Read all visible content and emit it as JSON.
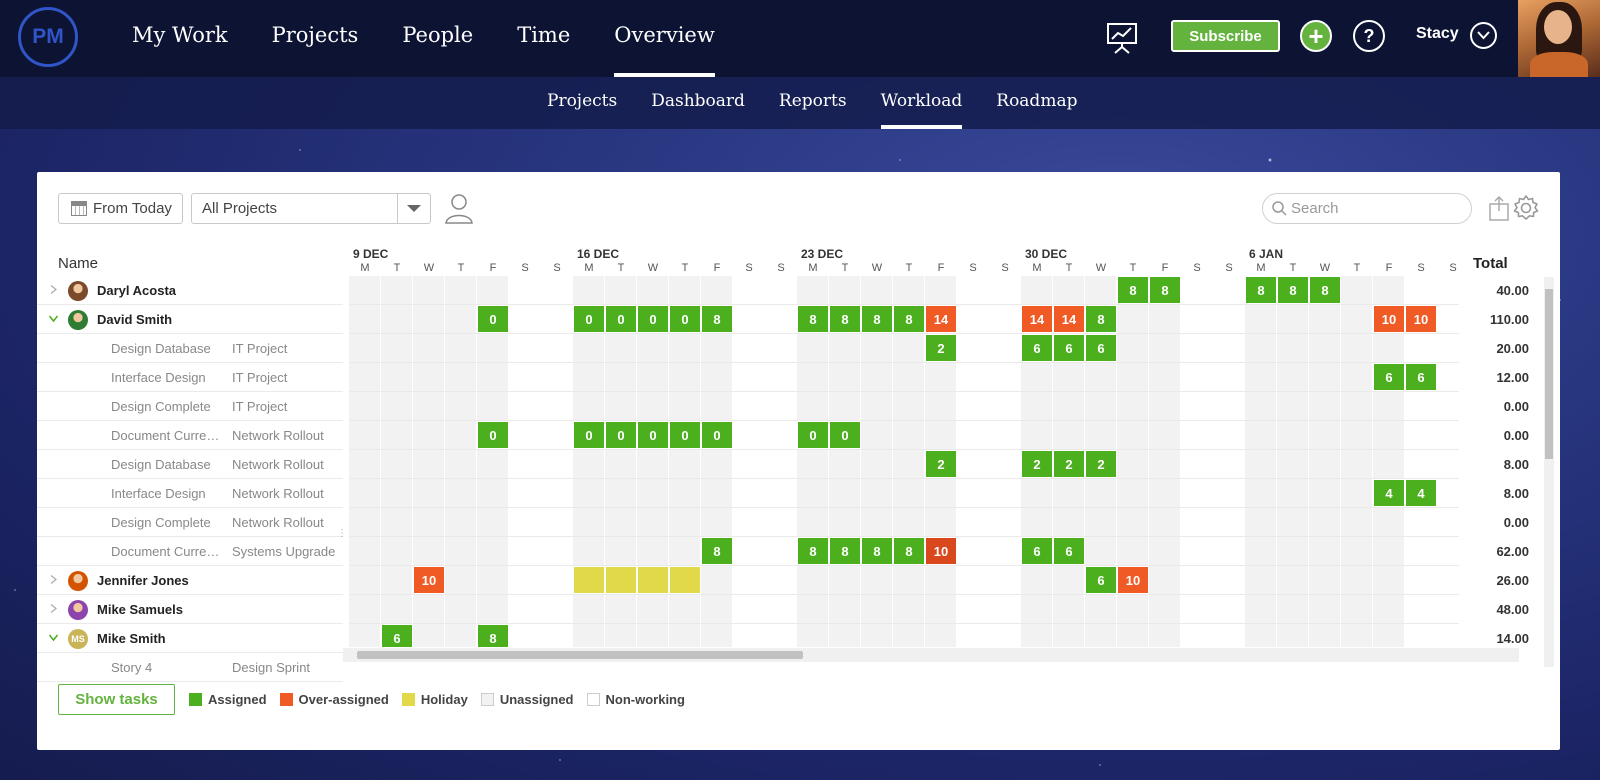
{
  "app": {
    "logo_text": "PM"
  },
  "main_nav": [
    {
      "label": "My Work",
      "active": false
    },
    {
      "label": "Projects",
      "active": false
    },
    {
      "label": "People",
      "active": false
    },
    {
      "label": "Time",
      "active": false
    },
    {
      "label": "Overview",
      "active": true
    }
  ],
  "sub_nav": [
    {
      "label": "Projects",
      "active": false
    },
    {
      "label": "Dashboard",
      "active": false
    },
    {
      "label": "Reports",
      "active": false
    },
    {
      "label": "Workload",
      "active": true
    },
    {
      "label": "Roadmap",
      "active": false
    }
  ],
  "header_actions": {
    "subscribe_label": "Subscribe",
    "user_name": "Stacy"
  },
  "toolbar": {
    "from_today_label": "From Today",
    "project_filter": "All Projects",
    "search_placeholder": "Search"
  },
  "colors": {
    "assigned": "#4caf1e",
    "over_assigned": "#f05a24",
    "over_assigned_dark": "#d9471d",
    "holiday": "#e2d94a",
    "unassigned": "#f2f2f2",
    "nonworking": "#ffffff",
    "accent": "#63b33e"
  },
  "grid": {
    "name_header": "Name",
    "total_header": "Total",
    "weeks": [
      "9 DEC",
      "16 DEC",
      "23 DEC",
      "30 DEC",
      "6 JAN"
    ],
    "day_letters": [
      "M",
      "T",
      "W",
      "T",
      "F",
      "S",
      "S"
    ],
    "rows": [
      {
        "type": "person",
        "name": "Daryl Acosta",
        "expanded": false,
        "avatar": "#7a4a2a",
        "total": "40.00",
        "cells": [
          [
            24,
            "8",
            "a"
          ],
          [
            25,
            "8",
            "a"
          ],
          [
            28,
            "8",
            "a"
          ],
          [
            29,
            "8",
            "a"
          ],
          [
            30,
            "8",
            "a"
          ]
        ]
      },
      {
        "type": "person",
        "name": "David Smith",
        "expanded": true,
        "avatar": "#2e7d32",
        "total": "110.00",
        "cells": [
          [
            4,
            "0",
            "a"
          ],
          [
            7,
            "0",
            "a"
          ],
          [
            8,
            "0",
            "a"
          ],
          [
            9,
            "0",
            "a"
          ],
          [
            10,
            "0",
            "a"
          ],
          [
            11,
            "8",
            "a"
          ],
          [
            14,
            "8",
            "a"
          ],
          [
            15,
            "8",
            "a"
          ],
          [
            16,
            "8",
            "a"
          ],
          [
            17,
            "8",
            "a"
          ],
          [
            18,
            "14",
            "o"
          ],
          [
            21,
            "14",
            "o"
          ],
          [
            22,
            "14",
            "o"
          ],
          [
            23,
            "8",
            "a"
          ],
          [
            32,
            "10",
            "o"
          ],
          [
            33,
            "10",
            "o"
          ]
        ]
      },
      {
        "type": "task",
        "task": "Design Database",
        "project": "IT Project",
        "total": "20.00",
        "cells": [
          [
            18,
            "2",
            "a"
          ],
          [
            21,
            "6",
            "a"
          ],
          [
            22,
            "6",
            "a"
          ],
          [
            23,
            "6",
            "a"
          ]
        ]
      },
      {
        "type": "task",
        "task": "Interface Design",
        "project": "IT Project",
        "total": "12.00",
        "cells": [
          [
            32,
            "6",
            "a"
          ],
          [
            33,
            "6",
            "a"
          ]
        ]
      },
      {
        "type": "task",
        "task": "Design Complete",
        "project": "IT Project",
        "total": "0.00",
        "cells": []
      },
      {
        "type": "task",
        "task": "Document Current...",
        "project": "Network Rollout",
        "total": "0.00",
        "cells": [
          [
            4,
            "0",
            "a"
          ],
          [
            7,
            "0",
            "a"
          ],
          [
            8,
            "0",
            "a"
          ],
          [
            9,
            "0",
            "a"
          ],
          [
            10,
            "0",
            "a"
          ],
          [
            11,
            "0",
            "a"
          ],
          [
            14,
            "0",
            "a"
          ],
          [
            15,
            "0",
            "a"
          ]
        ]
      },
      {
        "type": "task",
        "task": "Design Database",
        "project": "Network Rollout",
        "total": "8.00",
        "cells": [
          [
            18,
            "2",
            "a"
          ],
          [
            21,
            "2",
            "a"
          ],
          [
            22,
            "2",
            "a"
          ],
          [
            23,
            "2",
            "a"
          ]
        ]
      },
      {
        "type": "task",
        "task": "Interface Design",
        "project": "Network Rollout",
        "total": "8.00",
        "cells": [
          [
            32,
            "4",
            "a"
          ],
          [
            33,
            "4",
            "a"
          ]
        ]
      },
      {
        "type": "task",
        "task": "Design Complete",
        "project": "Network Rollout",
        "total": "0.00",
        "cells": []
      },
      {
        "type": "task",
        "task": "Document Current...",
        "project": "Systems Upgrade",
        "total": "62.00",
        "cells": [
          [
            11,
            "8",
            "a"
          ],
          [
            14,
            "8",
            "a"
          ],
          [
            15,
            "8",
            "a"
          ],
          [
            16,
            "8",
            "a"
          ],
          [
            17,
            "8",
            "a"
          ],
          [
            18,
            "10",
            "od"
          ],
          [
            21,
            "6",
            "a"
          ],
          [
            22,
            "6",
            "a"
          ]
        ]
      },
      {
        "type": "person",
        "name": "Jennifer Jones",
        "expanded": false,
        "avatar": "#d35400",
        "total": "26.00",
        "cells": [
          [
            2,
            "10",
            "o"
          ],
          [
            7,
            "",
            "h"
          ],
          [
            8,
            "",
            "h"
          ],
          [
            9,
            "",
            "h"
          ],
          [
            10,
            "",
            "h"
          ],
          [
            23,
            "6",
            "a"
          ],
          [
            24,
            "10",
            "o"
          ]
        ]
      },
      {
        "type": "person",
        "name": "Mike Samuels",
        "expanded": false,
        "avatar": "#8e44ad",
        "total": "48.00",
        "cells": []
      },
      {
        "type": "person",
        "name": "Mike Smith",
        "expanded": true,
        "avatar": "#c9b458",
        "avatar_initials": "MS",
        "total": "14.00",
        "cells": [
          [
            1,
            "6",
            "a"
          ],
          [
            4,
            "8",
            "a"
          ]
        ]
      },
      {
        "type": "task",
        "task": "Story 4",
        "project": "Design Sprint",
        "total": "",
        "cells": []
      }
    ]
  },
  "legend": {
    "show_tasks_label": "Show tasks",
    "items": [
      {
        "label": "Assigned",
        "color": "#4caf1e"
      },
      {
        "label": "Over-assigned",
        "color": "#f05a24"
      },
      {
        "label": "Holiday",
        "color": "#e2d94a"
      },
      {
        "label": "Unassigned",
        "color": "#f2f2f2"
      },
      {
        "label": "Non-working",
        "color": "#ffffff"
      }
    ]
  }
}
